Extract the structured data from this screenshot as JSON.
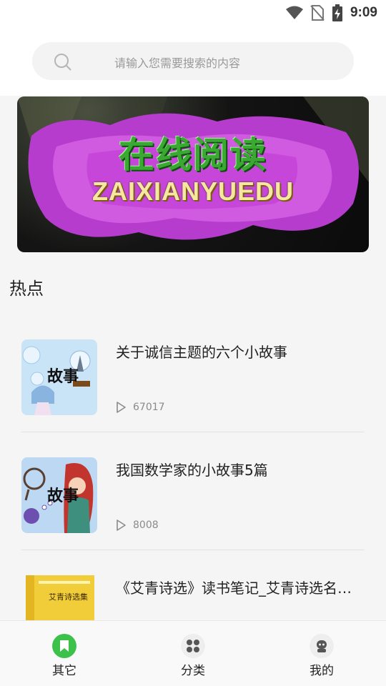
{
  "status_bar": {
    "time": "9:09"
  },
  "search": {
    "placeholder": "请输入您需要搜索的内容"
  },
  "banner": {
    "title_cn": "在线阅读",
    "title_en": "ZAIXIANYUEDU"
  },
  "section": {
    "title": "热点"
  },
  "articles": [
    {
      "title": "关于诚信主题的六个小故事",
      "views": "67017",
      "thumb_label": "故事"
    },
    {
      "title": "我国数学家的小故事5篇",
      "views": "8008",
      "thumb_label": "故事"
    },
    {
      "title": "《艾青诗选》读书笔记_艾青诗选名句摘抄",
      "views": "",
      "thumb_label": "艾青诗选集"
    }
  ],
  "bottom_nav": [
    {
      "label": "其它",
      "icon": "bookmark-icon",
      "active": true
    },
    {
      "label": "分类",
      "icon": "grid-icon",
      "active": false
    },
    {
      "label": "我的",
      "icon": "user-icon",
      "active": false
    }
  ],
  "colors": {
    "accent": "#3cc14a",
    "placeholder": "#9a9a9a",
    "banner_magenta": "#c23fd6"
  }
}
